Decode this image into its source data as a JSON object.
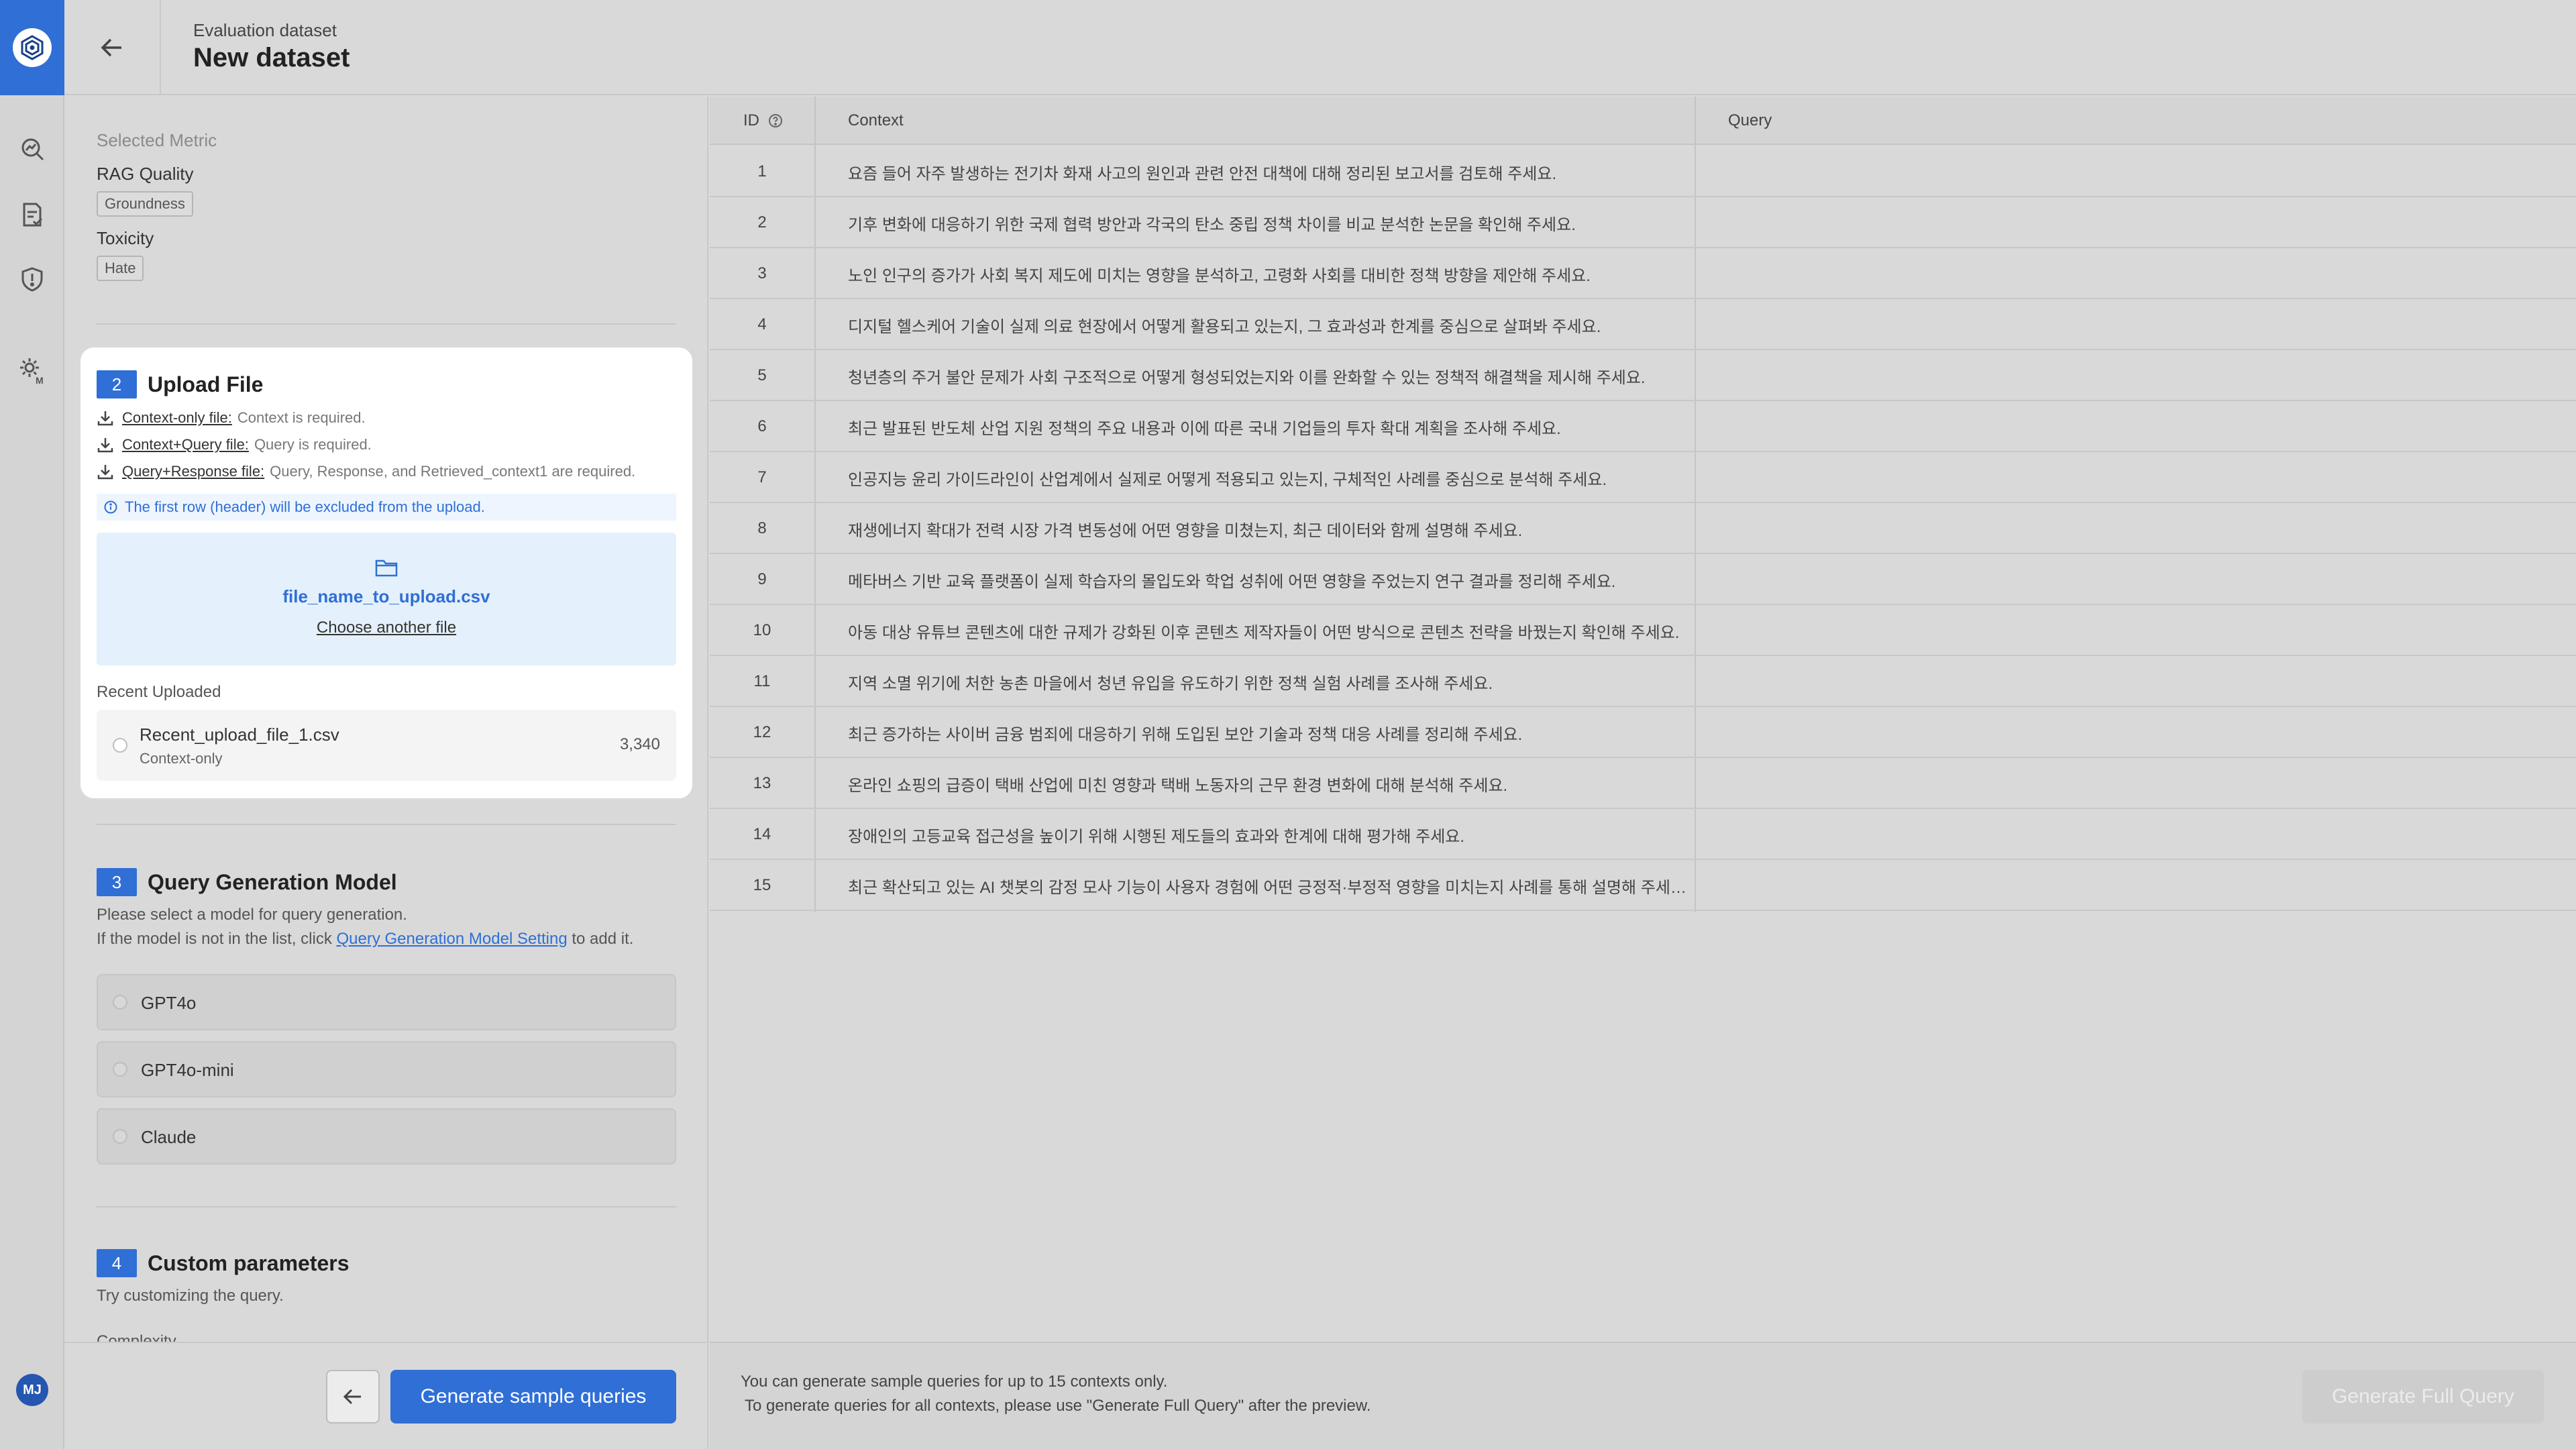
{
  "header": {
    "subtitle": "Evaluation dataset",
    "title": "New dataset"
  },
  "user": {
    "initials": "MJ"
  },
  "selected_metric": {
    "label": "Selected Metric",
    "groups": [
      {
        "name": "RAG Quality",
        "chip": "Groundness"
      },
      {
        "name": "Toxicity",
        "chip": "Hate"
      }
    ]
  },
  "upload": {
    "step": "2",
    "title": "Upload File",
    "requirements": [
      {
        "link": "Context-only file:",
        "text": "Context is required."
      },
      {
        "link": "Context+Query file:",
        "text": "Query is required."
      },
      {
        "link": "Query+Response file:",
        "text": "Query, Response, and Retrieved_context1 are required."
      }
    ],
    "info": "The first row (header) will be excluded from the upload.",
    "file_name": "file_name_to_upload.csv",
    "choose_another": "Choose another file",
    "recent_title": "Recent Uploaded",
    "recent": {
      "name": "Recent_upload_file_1.csv",
      "type": "Context-only",
      "count": "3,340"
    }
  },
  "query_model": {
    "step": "3",
    "title": "Query Generation Model",
    "desc1": "Please select a model for query generation.",
    "desc2_prefix": "If the model is not in the list, click",
    "desc2_link": "Query Generation Model Setting",
    "desc2_suffix": "to add it.",
    "models": [
      "GPT4o",
      "GPT4o-mini",
      "Claude"
    ]
  },
  "custom": {
    "step": "4",
    "title": "Custom parameters",
    "desc": "Try customizing the query.",
    "cut_label": "Complexity"
  },
  "actions": {
    "generate_sample": "Generate sample queries",
    "generate_full": "Generate Full Query"
  },
  "table": {
    "headers": {
      "id": "ID",
      "context": "Context",
      "query": "Query"
    },
    "rows": [
      {
        "id": "1",
        "context": "요즘 들어 자주 발생하는 전기차 화재 사고의 원인과 관련 안전 대책에 대해 정리된 보고서를 검토해 주세요."
      },
      {
        "id": "2",
        "context": "기후 변화에 대응하기 위한 국제 협력 방안과 각국의 탄소 중립 정책 차이를 비교 분석한 논문을 확인해 주세요."
      },
      {
        "id": "3",
        "context": "노인 인구의 증가가 사회 복지 제도에 미치는 영향을 분석하고, 고령화 사회를 대비한 정책 방향을 제안해 주세요."
      },
      {
        "id": "4",
        "context": "디지털 헬스케어 기술이 실제 의료 현장에서 어떻게 활용되고 있는지, 그 효과성과 한계를 중심으로 살펴봐 주세요."
      },
      {
        "id": "5",
        "context": "청년층의 주거 불안 문제가 사회 구조적으로 어떻게 형성되었는지와 이를 완화할 수 있는 정책적 해결책을 제시해 주세요."
      },
      {
        "id": "6",
        "context": "최근 발표된 반도체 산업 지원 정책의 주요 내용과 이에 따른 국내 기업들의 투자 확대 계획을 조사해 주세요."
      },
      {
        "id": "7",
        "context": "인공지능 윤리 가이드라인이 산업계에서 실제로 어떻게 적용되고 있는지, 구체적인 사례를 중심으로 분석해 주세요."
      },
      {
        "id": "8",
        "context": "재생에너지 확대가 전력 시장 가격 변동성에 어떤 영향을 미쳤는지, 최근 데이터와 함께 설명해 주세요."
      },
      {
        "id": "9",
        "context": "메타버스 기반 교육 플랫폼이 실제 학습자의 몰입도와 학업 성취에 어떤 영향을 주었는지 연구 결과를 정리해 주세요."
      },
      {
        "id": "10",
        "context": "아동 대상 유튜브 콘텐츠에 대한 규제가 강화된 이후 콘텐츠 제작자들이 어떤 방식으로 콘텐츠 전략을 바꿨는지 확인해 주세요."
      },
      {
        "id": "11",
        "context": "지역 소멸 위기에 처한 농촌 마을에서 청년 유입을 유도하기 위한 정책 실험 사례를 조사해 주세요."
      },
      {
        "id": "12",
        "context": "최근 증가하는 사이버 금융 범죄에 대응하기 위해 도입된 보안 기술과 정책 대응 사례를 정리해 주세요."
      },
      {
        "id": "13",
        "context": "온라인 쇼핑의 급증이 택배 산업에 미친 영향과 택배 노동자의 근무 환경 변화에 대해 분석해 주세요."
      },
      {
        "id": "14",
        "context": "장애인의 고등교육 접근성을 높이기 위해 시행된 제도들의 효과와 한계에 대해 평가해 주세요."
      },
      {
        "id": "15",
        "context": "최근 확산되고 있는 AI 챗봇의 감정 모사 기능이 사용자 경험에 어떤 긍정적·부정적 영향을 미치는지 사례를 통해 설명해 주세…"
      }
    ]
  },
  "footer_note": {
    "line1": "You can generate sample queries for up to 15 contexts only.",
    "line2": "To generate queries for all contexts, please use \"Generate Full Query\" after the preview."
  }
}
